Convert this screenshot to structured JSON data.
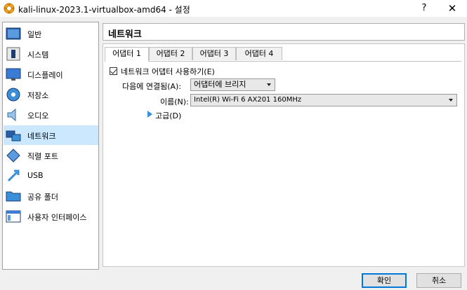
{
  "window": {
    "title": "kali-linux-2023.1-virtualbox-amd64 - 설정",
    "help_label": "?",
    "close_label": "✕"
  },
  "sidebar": {
    "items": [
      {
        "label": "일반",
        "icon": "general-icon"
      },
      {
        "label": "시스템",
        "icon": "system-icon"
      },
      {
        "label": "디스플레이",
        "icon": "display-icon"
      },
      {
        "label": "저장소",
        "icon": "storage-icon"
      },
      {
        "label": "오디오",
        "icon": "audio-icon"
      },
      {
        "label": "네트워크",
        "icon": "network-icon",
        "selected": true
      },
      {
        "label": "직렬 포트",
        "icon": "serial-port-icon"
      },
      {
        "label": "USB",
        "icon": "usb-icon"
      },
      {
        "label": "공유 폴더",
        "icon": "shared-folder-icon"
      },
      {
        "label": "사용자 인터페이스",
        "icon": "user-interface-icon"
      }
    ]
  },
  "content": {
    "title": "네트워크",
    "tabs": [
      {
        "label": "어댑터 1",
        "active": true
      },
      {
        "label": "어댑터 2"
      },
      {
        "label": "어댑터 3"
      },
      {
        "label": "어댑터 4"
      }
    ],
    "enable_label": "네트워크 어댑터 사용하기(E)",
    "enable_checked": true,
    "attached_label": "다음에 연결됨(A):",
    "attached_value": "어댑터에 브리지",
    "name_label": "이름(N):",
    "name_value": "Intel(R) Wi-Fi 6 AX201 160MHz",
    "advanced_label": "고급(D)"
  },
  "buttons": {
    "ok": "확인",
    "cancel": "취소"
  },
  "colors": {
    "selected_bg": "#cce8ff",
    "accent": "#0078d7",
    "arrow": "#3a8fd8"
  }
}
